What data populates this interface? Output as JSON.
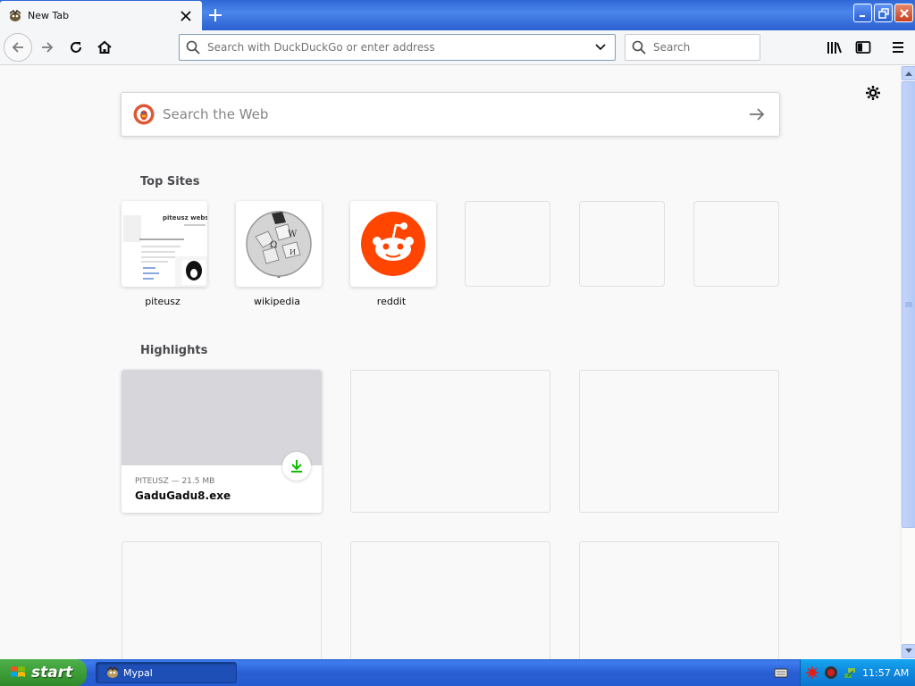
{
  "window": {
    "tab_title": "New Tab",
    "colors": {
      "titlebar": "#2f67d6",
      "accent_green": "#12bc00",
      "reddit": "#ff4500"
    }
  },
  "navbar": {
    "url_placeholder": "Search with DuckDuckGo or enter address",
    "search_placeholder": "Search",
    "icons": [
      "back-arrow-icon",
      "forward-arrow-icon",
      "reload-icon",
      "home-icon",
      "library-icon",
      "sidebar-icon",
      "hamburger-menu-icon"
    ]
  },
  "newtab": {
    "websearch_placeholder": "Search the Web",
    "top_sites_title": "Top Sites",
    "highlights_title": "Highlights",
    "top_sites": [
      {
        "label": "piteusz"
      },
      {
        "label": "wikipedia"
      },
      {
        "label": "reddit"
      }
    ],
    "piteusz_thumb_text": "piteusz website",
    "highlights": [
      {
        "meta": "PITEUSZ — 21.5 MB",
        "name": "GaduGadu8.exe"
      }
    ]
  },
  "taskbar": {
    "start_label": "start",
    "task_label": "Mypal",
    "clock": "11:57 AM"
  }
}
